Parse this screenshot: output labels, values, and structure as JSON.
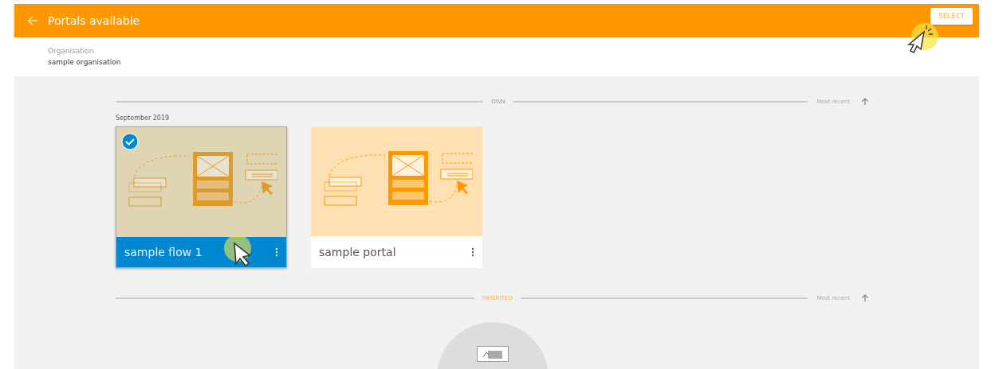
{
  "header": {
    "title": "Portals available",
    "action": "SELECT"
  },
  "organisation": {
    "label": "Organisation",
    "value": "sample organisation"
  },
  "sections": [
    {
      "label": "OWN",
      "sort": "Most recent",
      "groups": [
        {
          "date": "September 2019",
          "cards": [
            {
              "name": "sample flow 1",
              "selected": true
            },
            {
              "name": "sample portal",
              "selected": false
            }
          ]
        }
      ]
    },
    {
      "label": "INHERITED",
      "sort": "Most recent"
    }
  ]
}
